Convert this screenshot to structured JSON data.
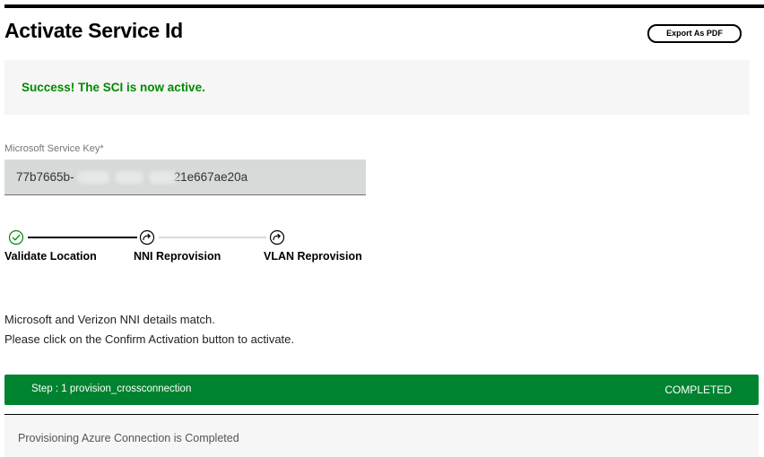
{
  "header": {
    "title": "Activate Service Id",
    "export_button": "Export As PDF"
  },
  "success": {
    "message": "Success! The SCI is now active.",
    "color": "#008a00"
  },
  "service_key": {
    "label": "Microsoft Service Key*",
    "value": "77b7665b-        -        -        -a21e667ae20a"
  },
  "stepper": {
    "steps": [
      {
        "label": "Validate Location",
        "status": "complete",
        "icon": "check-circle-icon"
      },
      {
        "label": "NNI Reprovision",
        "status": "pending",
        "icon": "redo-circle-icon"
      },
      {
        "label": "VLAN Reprovision",
        "status": "pending",
        "icon": "redo-circle-icon"
      }
    ],
    "colors": {
      "complete": "#008a00",
      "active_line": "#000000",
      "inactive_line": "#d8dada"
    }
  },
  "instructions": {
    "line1": "Microsoft and Verizon NNI details match.",
    "line2": "Please click on the Confirm Activation button to activate."
  },
  "provision_step": {
    "title": "Step : 1 provision_crossconnection",
    "status": "COMPLETED",
    "color": "#008330",
    "detail": "Provisioning Azure Connection is Completed"
  }
}
